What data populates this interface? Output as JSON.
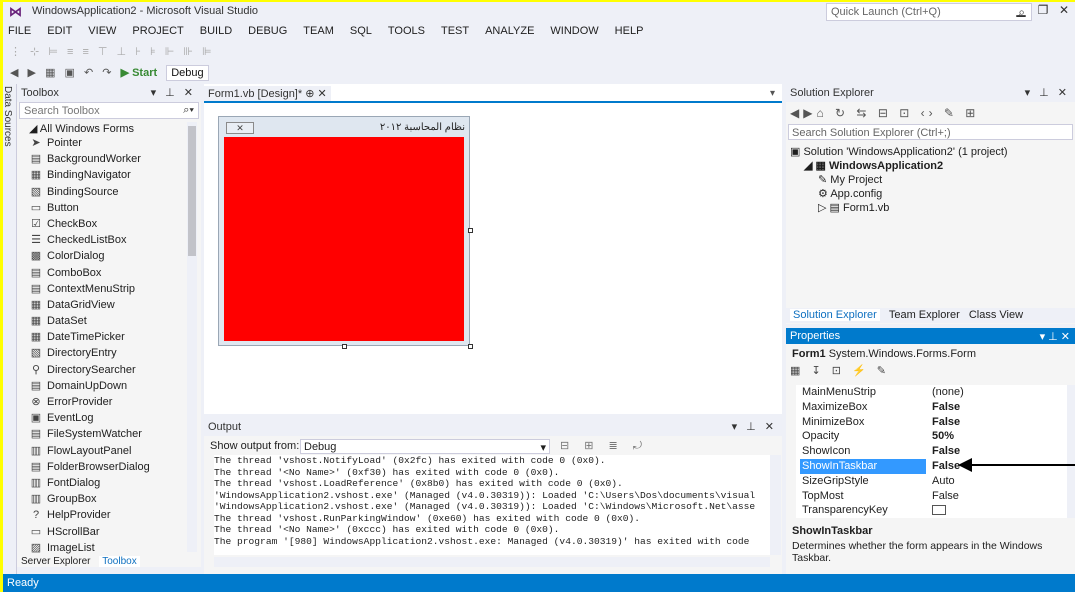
{
  "window": {
    "title": "WindowsApplication2 - Microsoft Visual Studio",
    "quick_launch": "Quick Launch (Ctrl+Q)"
  },
  "menu": [
    "FILE",
    "EDIT",
    "VIEW",
    "PROJECT",
    "BUILD",
    "DEBUG",
    "TEAM",
    "SQL",
    "TOOLS",
    "TEST",
    "ANALYZE",
    "WINDOW",
    "HELP"
  ],
  "toolbar": {
    "start": "▶ Start",
    "config": "Debug"
  },
  "side_strip": "Data Sources",
  "toolbox": {
    "title": "Toolbox",
    "search_placeholder": "Search Toolbox",
    "group": "◢ All Windows Forms",
    "items": [
      "Pointer",
      "BackgroundWorker",
      "BindingNavigator",
      "BindingSource",
      "Button",
      "CheckBox",
      "CheckedListBox",
      "ColorDialog",
      "ComboBox",
      "ContextMenuStrip",
      "DataGridView",
      "DataSet",
      "DateTimePicker",
      "DirectoryEntry",
      "DirectorySearcher",
      "DomainUpDown",
      "ErrorProvider",
      "EventLog",
      "FileSystemWatcher",
      "FlowLayoutPanel",
      "FolderBrowserDialog",
      "FontDialog",
      "GroupBox",
      "HelpProvider",
      "HScrollBar",
      "ImageList"
    ],
    "tabs": [
      "Server Explorer",
      "Toolbox"
    ]
  },
  "doc": {
    "tab": "Form1.vb [Design]*",
    "form_title": "نظام المحاسبة ٢٠١٢"
  },
  "output": {
    "title": "Output",
    "show_from_label": "Show output from:",
    "show_from_value": "Debug",
    "lines": [
      "The thread 'vshost.NotifyLoad' (0x2fc) has exited with code 0 (0x0).",
      "The thread '<No Name>' (0xf30) has exited with code 0 (0x0).",
      "The thread 'vshost.LoadReference' (0x8b0) has exited with code 0 (0x0).",
      "'WindowsApplication2.vshost.exe' (Managed (v4.0.30319)): Loaded 'C:\\Users\\Dos\\documents\\visual",
      "'WindowsApplication2.vshost.exe' (Managed (v4.0.30319)): Loaded 'C:\\Windows\\Microsoft.Net\\asse",
      "The thread 'vshost.RunParkingWindow' (0xe60) has exited with code 0 (0x0).",
      "The thread '<No Name>' (0xccc) has exited with code 0 (0x0).",
      "The program '[980] WindowsApplication2.vshost.exe: Managed (v4.0.30319)' has exited with code"
    ]
  },
  "solution_explorer": {
    "title": "Solution Explorer",
    "search_placeholder": "Search Solution Explorer (Ctrl+;)",
    "nodes": [
      {
        "label": "Solution 'WindowsApplication2' (1 project)",
        "level": 0
      },
      {
        "label": "WindowsApplication2",
        "level": 1
      },
      {
        "label": "My Project",
        "level": 2
      },
      {
        "label": "App.config",
        "level": 2
      },
      {
        "label": "Form1.vb",
        "level": 2
      }
    ],
    "tabs": [
      "Solution Explorer",
      "Team Explorer",
      "Class View"
    ]
  },
  "properties": {
    "title": "Properties",
    "object": "Form1",
    "object_type": "System.Windows.Forms.Form",
    "rows": [
      {
        "name": "MainMenuStrip",
        "value": "(none)",
        "bold": false
      },
      {
        "name": "MaximizeBox",
        "value": "False",
        "bold": true
      },
      {
        "name": "MinimizeBox",
        "value": "False",
        "bold": true
      },
      {
        "name": "Opacity",
        "value": "50%",
        "bold": true
      },
      {
        "name": "ShowIcon",
        "value": "False",
        "bold": true
      },
      {
        "name": "ShowInTaskbar",
        "value": "False",
        "bold": true,
        "selected": true
      },
      {
        "name": "SizeGripStyle",
        "value": "Auto",
        "bold": false
      },
      {
        "name": "TopMost",
        "value": "False",
        "bold": false
      },
      {
        "name": "TransparencyKey",
        "value": "",
        "bold": false
      }
    ],
    "desc_title": "ShowInTaskbar",
    "desc_text": "Determines whether the form appears in the Windows Taskbar."
  },
  "status": "Ready",
  "colors": {
    "accent": "#007acc",
    "form_client": "#ff0000",
    "annotation": "#ffff00"
  }
}
